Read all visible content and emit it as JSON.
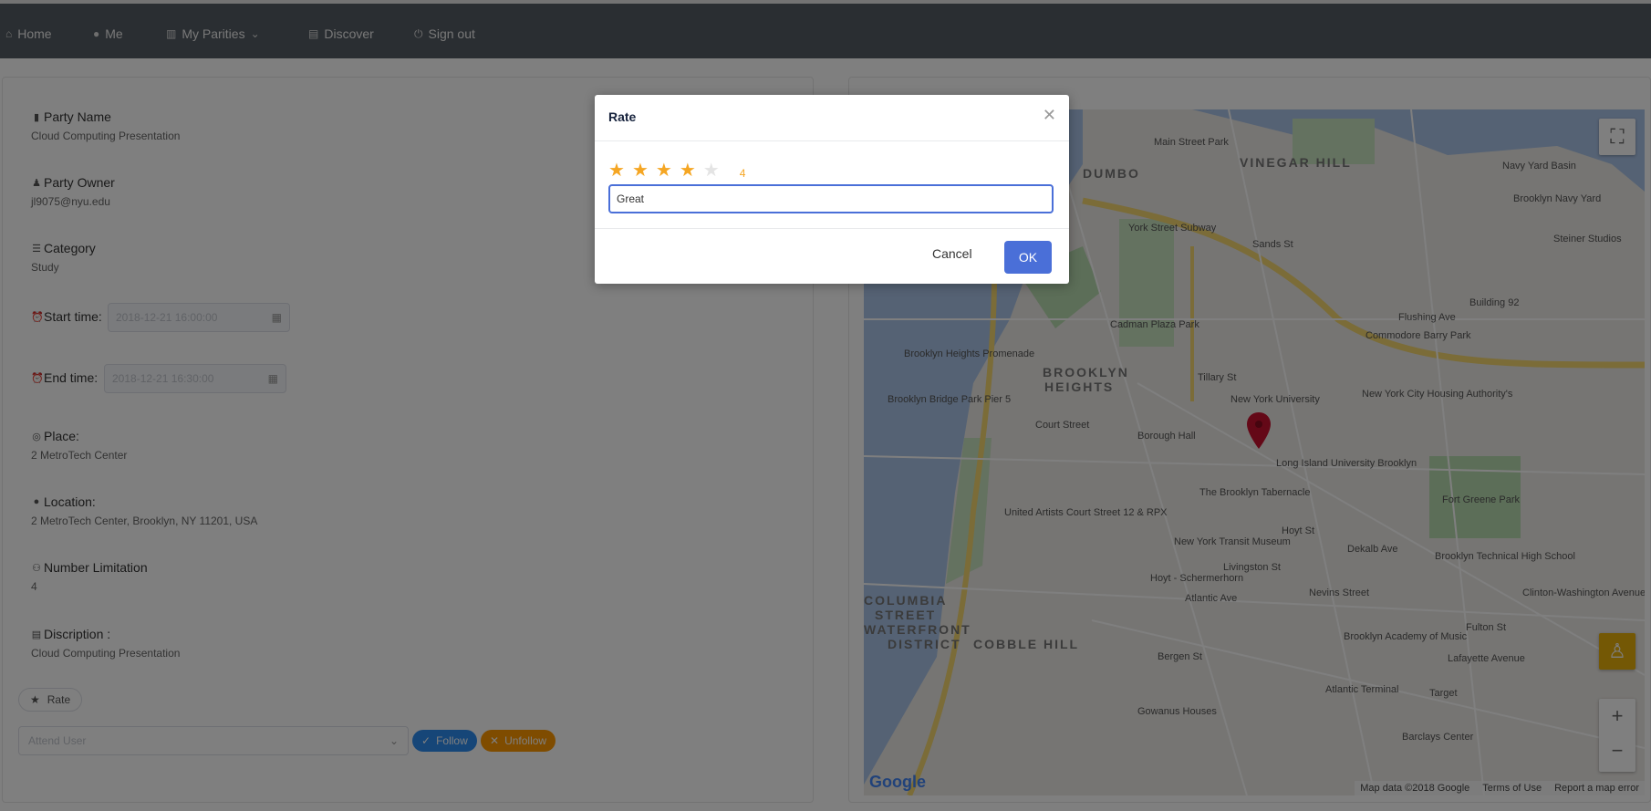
{
  "nav": {
    "home": "Home",
    "me": "Me",
    "my_parties": "My Parities",
    "discover": "Discover",
    "sign_out": "Sign out"
  },
  "party": {
    "name_label": "Party Name",
    "name_value": "Cloud Computing Presentation",
    "owner_label": "Party Owner",
    "owner_value": "jl9075@nyu.edu",
    "category_label": "Category",
    "category_value": "Study",
    "start_label": "Start time:",
    "start_value": "2018-12-21 16:00:00",
    "end_label": "End time:",
    "end_value": "2018-12-21 16:30:00",
    "place_label": "Place:",
    "place_value": "2 MetroTech Center",
    "location_label": "Location:",
    "location_value": "2 MetroTech Center, Brooklyn, NY 11201, USA",
    "limit_label": "Number Limitation",
    "limit_value": "4",
    "description_label": "Discription :",
    "description_value": "Cloud Computing Presentation"
  },
  "actions": {
    "rate": "Rate",
    "attend_placeholder": "Attend User",
    "follow": "Follow",
    "unfollow": "Unfollow"
  },
  "map": {
    "areas": [
      "VINEGAR HILL",
      "DUMBO",
      "BROOKLYN",
      "HEIGHTS",
      "COLUMBIA",
      "STREET",
      "WATERFRONT",
      "DISTRICT",
      "COBBLE HILL"
    ],
    "labels": [
      "Main Street Park",
      "York Street Subway",
      "Brooklyn Navy Yard",
      "Navy Yard Basin",
      "Steiner Studios",
      "Building 92",
      "Commodore Barry Park",
      "Cadman Plaza Park",
      "Brooklyn Heights Promenade",
      "Brooklyn Bridge Park Pier 5",
      "Court Street",
      "Borough Hall",
      "New York University",
      "New York City Housing Authority's",
      "Long Island University Brooklyn",
      "The Brooklyn Tabernacle",
      "Fort Greene Park",
      "Hoyt St",
      "New York Transit Museum",
      "United Artists Court Street 12 & RPX",
      "Hoyt - Schermerhorn",
      "Nevins Street",
      "Brooklyn Technical High School",
      "Clinton-Washington Avenues",
      "Fulton St",
      "Brooklyn Academy of Music",
      "Lafayette Avenue",
      "Atlantic Terminal",
      "Target",
      "Barclays Center",
      "Bergen St",
      "Gowanus Houses",
      "Dekalb Ave",
      "Flushing Ave",
      "Sands St",
      "Tillary St",
      "Livingston St",
      "Atlantic Ave"
    ],
    "attribution": "Map data ©2018 Google",
    "terms": "Terms of Use",
    "report": "Report a map error",
    "google": "Google"
  },
  "modal": {
    "title": "Rate",
    "rating": 4,
    "max_rating": 5,
    "rating_label": "4",
    "comment": "Great",
    "cancel": "Cancel",
    "ok": "OK"
  },
  "colors": {
    "nav_bg": "#545c64",
    "primary": "#4a6fd8",
    "star": "#f5a623",
    "follow": "#2d8cf0",
    "unfollow": "#ff9900"
  }
}
